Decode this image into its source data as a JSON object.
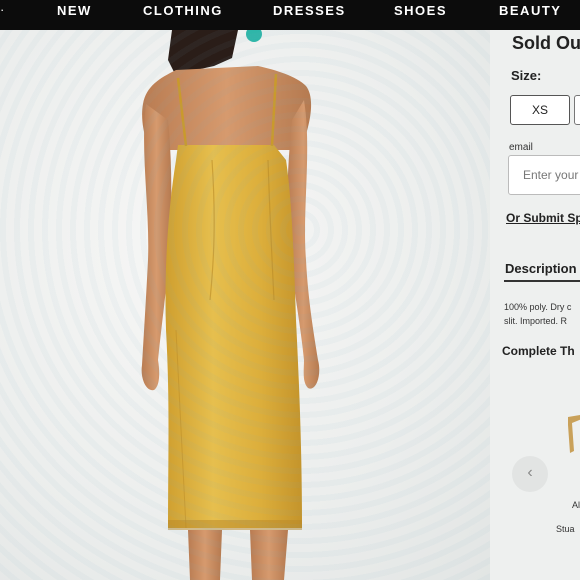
{
  "nav": {
    "lead": "·",
    "items": [
      "NEW",
      "CLOTHING",
      "DRESSES",
      "SHOES",
      "BEAUTY"
    ]
  },
  "product": {
    "status": "Sold Ou",
    "size_label": "Size:",
    "sizes": [
      "XS"
    ],
    "email_label": "email",
    "email_placeholder": "Enter your",
    "submit_link": "Or Submit Sp",
    "description_heading": "Description",
    "description_lines": [
      "100% poly. Dry c",
      "slit. Imported. R"
    ],
    "complete_heading": "Complete Th",
    "carousel": {
      "prev_icon": "‹",
      "caption_1": "Al",
      "caption_2": "Stua"
    }
  },
  "colors": {
    "nav_bg": "#0c0c0c",
    "dress": "#d9ad3a",
    "skin": "#c98f64"
  }
}
